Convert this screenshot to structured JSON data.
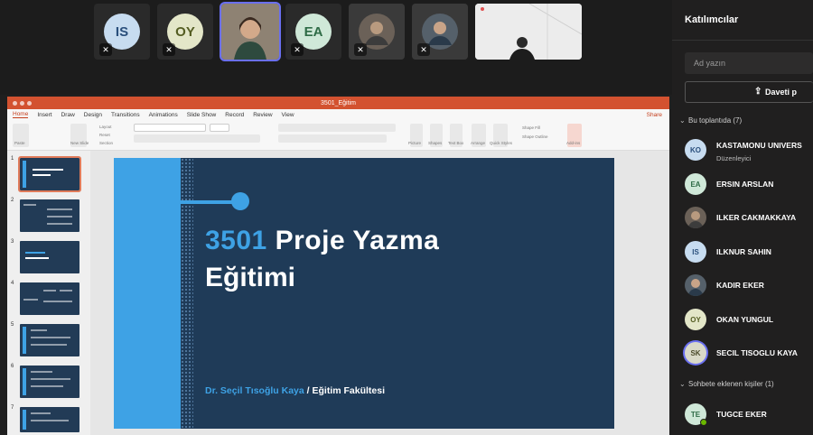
{
  "video_strip": {
    "tiles": [
      {
        "initials": "IS",
        "bg": "#c7dcf0",
        "fg": "#2a4f7c"
      },
      {
        "initials": "OY",
        "bg": "#e3e6c8",
        "fg": "#545d22"
      },
      {
        "initials": "",
        "bg": "#c9b6a2",
        "fg": "#000000"
      },
      {
        "initials": "EA",
        "bg": "#cfe8d8",
        "fg": "#2e6b46"
      },
      {
        "initials": "",
        "bg": "#6b6158",
        "fg": "#000000"
      },
      {
        "initials": "",
        "bg": "#55606a",
        "fg": "#000000"
      },
      {
        "initials": "",
        "bg": "#e8e8e8",
        "fg": "#000000"
      }
    ]
  },
  "ppt": {
    "filename": "3501_Eğitim",
    "menu": [
      "Home",
      "Insert",
      "Draw",
      "Design",
      "Transitions",
      "Animations",
      "Slide Show",
      "Record",
      "Review",
      "View"
    ],
    "share": "Share",
    "ribbon_labels": [
      "Paste",
      "New Slide",
      "Layout",
      "Reset",
      "Section",
      "Picture",
      "Shapes",
      "Text Box",
      "Arrange",
      "Quick Styles",
      "Shape Fill",
      "Shape Outline",
      "Add-ins"
    ],
    "slide_numbers": [
      "1",
      "2",
      "3",
      "4",
      "5",
      "6",
      "7"
    ],
    "slide": {
      "title_number": "3501",
      "title_rest": "Proje Yazma",
      "title_line2": "Eğitimi",
      "author": "Dr. Seçil Tısoğlu Kaya",
      "separator": "/",
      "faculty": "Eğitim Fakültesi"
    }
  },
  "panel": {
    "title": "Katılımcılar",
    "search_placeholder": "Ad yazın",
    "invite_label": "Daveti p",
    "section_meeting": "Bu toplantıda (7)",
    "section_chat": "Sohbete eklenen kişiler (1)",
    "people": [
      {
        "name": "KASTAMONU UNIVERS",
        "role": "Düzenleyici",
        "initials": "KO",
        "bg": "#c7dcf0",
        "fg": "#2a4f7c"
      },
      {
        "name": "ERSIN ARSLAN",
        "initials": "EA",
        "bg": "#cfe8d8",
        "fg": "#2e6b46"
      },
      {
        "name": "ILKER CAKMAKKAYA",
        "initials": "",
        "bg": "#6b6158",
        "fg": "#ffffff"
      },
      {
        "name": "ILKNUR SAHIN",
        "initials": "IS",
        "bg": "#c7dcf0",
        "fg": "#2a4f7c"
      },
      {
        "name": "KADIR EKER",
        "initials": "",
        "bg": "#55606a",
        "fg": "#ffffff"
      },
      {
        "name": "OKAN YUNGUL",
        "initials": "OY",
        "bg": "#e3e6c8",
        "fg": "#545d22"
      },
      {
        "name": "SECIL TISOGLU KAYA",
        "initials": "SK",
        "bg": "#d9d9c8",
        "fg": "#4a4a2a"
      }
    ],
    "chat_people": [
      {
        "name": "TUGCE EKER",
        "initials": "TE",
        "bg": "#cfe8d8",
        "fg": "#2e6b46"
      }
    ]
  }
}
